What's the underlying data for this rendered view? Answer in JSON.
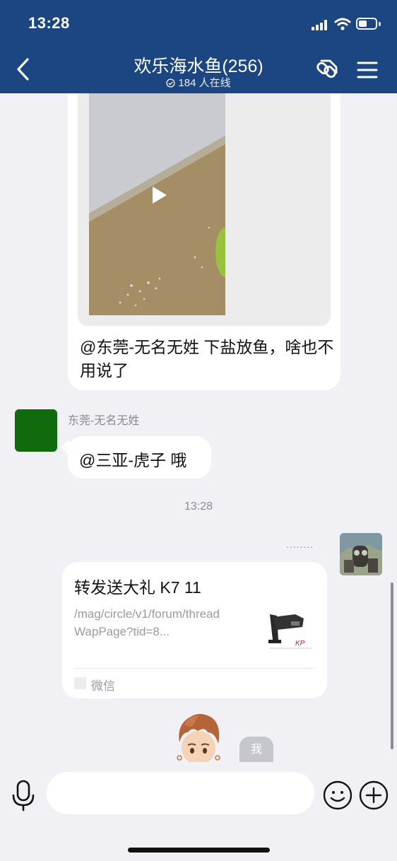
{
  "status_bar": {
    "time": "13:28"
  },
  "header": {
    "title": "欢乐海水鱼(256)",
    "online_text": "184 人在线"
  },
  "messages": {
    "video_caption": "@东莞-无名无姓 下盐放鱼，啥也不用说了",
    "reply_sender": "东莞-无名无姓",
    "reply_text": "@三亚-虎子 哦",
    "time_separator": "13:28",
    "my_name": "........",
    "share": {
      "title": "转发送大礼 K7 11",
      "desc": "/mag/circle/v1/forum/threadWapPage?tid=8...",
      "source": "微信"
    },
    "me_badge": "我"
  },
  "input": {
    "value": "",
    "placeholder": ""
  },
  "colors": {
    "header_bg": "#1b4682",
    "chat_bg": "#f1f1f5",
    "bubble_bg": "#ffffff",
    "avatar_green": "#116a0c"
  },
  "icons": {
    "back": "chevron-left-icon",
    "group_settings": "link-tag-icon",
    "menu": "hamburger-menu-icon",
    "voice": "microphone-icon",
    "emoji": "smiley-icon",
    "more": "plus-circle-icon"
  }
}
